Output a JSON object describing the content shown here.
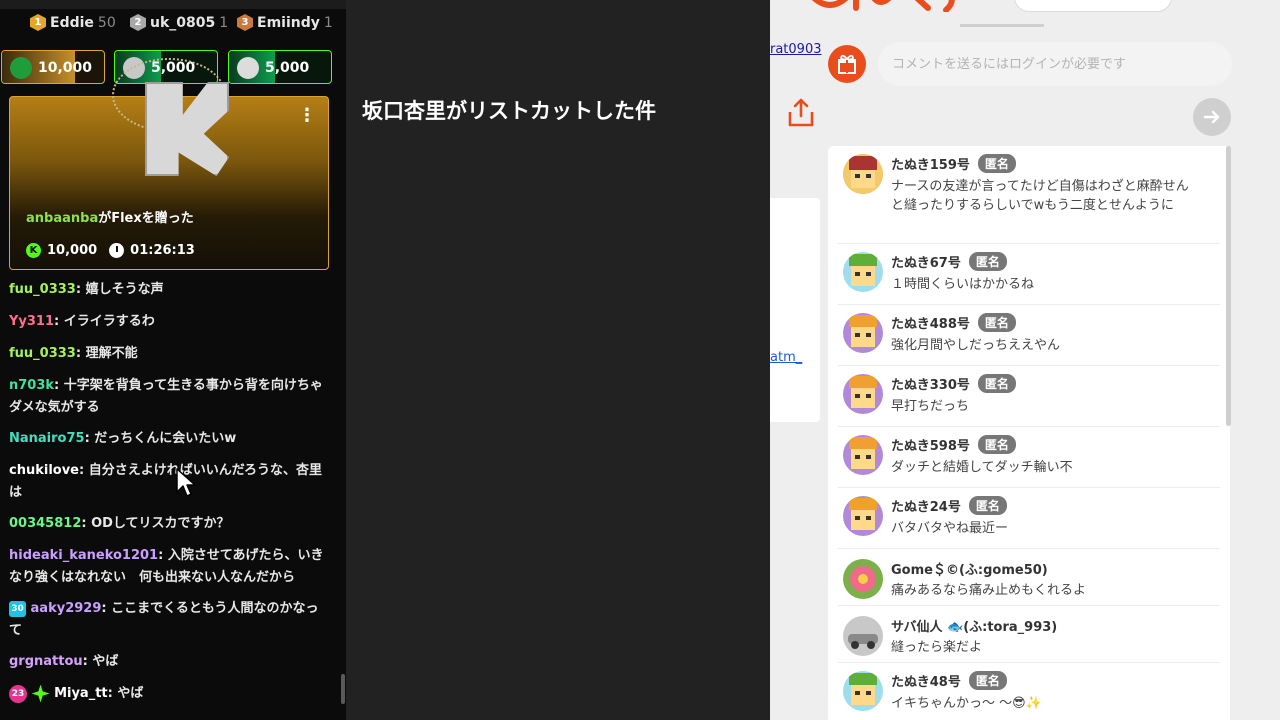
{
  "leaderboard": [
    {
      "rank": "1",
      "name": "Eddie",
      "score": "50",
      "color": "#e3a82b"
    },
    {
      "rank": "2",
      "name": "uk_0805",
      "score": "1",
      "color": "#a8a8a8"
    },
    {
      "rank": "3",
      "name": "Emiindy",
      "score": "1",
      "color": "#c97a3e"
    }
  ],
  "gift_pills": [
    {
      "amount": "10,000",
      "border": "#e0a52e",
      "fill": "#c7902a",
      "fill_fraction": 0.72
    },
    {
      "amount": "5,000",
      "border": "#53fc18",
      "fill": "#0d9d4f",
      "fill_fraction": 0.45
    },
    {
      "amount": "5,000",
      "border": "#53fc18",
      "fill": "#0d9d4f",
      "fill_fraction": 0.45
    }
  ],
  "gift_card": {
    "username": "anbaanba",
    "text": "がFlexを贈った",
    "coins": "10,000",
    "time": "01:26:13"
  },
  "chat": [
    {
      "user": "fuu_0333",
      "color": "#a6f05a",
      "text": ": 嬉しそうな声"
    },
    {
      "user": "Yy311",
      "color": "#ff6e8e",
      "text": ": イライラするわ"
    },
    {
      "user": "fuu_0333",
      "color": "#a6f05a",
      "text": ": 理解不能"
    },
    {
      "user": "n703k",
      "color": "#3fe0a0",
      "text": ": 十字架を背負って生きる事から背を向けちゃダメな気がする"
    },
    {
      "user": "Nanairo75",
      "color": "#3fe0c0",
      "text": ": だっちくんに会いたいw"
    },
    {
      "user": "chukilove",
      "color": "#ffffff",
      "text": ": 自分さえよければいいんだろうな、杏里は"
    },
    {
      "user": "00345812",
      "color": "#6cf58a",
      "text": ": ODしてリスカですか？"
    },
    {
      "user": "hideaki_kaneko1201",
      "color": "#c9a0ff",
      "text": ": 入院させてあげたら、いきなり強くはなれない　何も出来ない人なんだから"
    },
    {
      "user": "aaky2929",
      "color": "#c9a0ff",
      "text": ": ここまでくるともう人間なのかなって",
      "badge": "30"
    },
    {
      "user": "grgnattou",
      "color": "#d6a0ff",
      "text": ": やば"
    },
    {
      "user": "Miya_tt",
      "color": "#ffffff",
      "text": ": やば",
      "badge": "23"
    }
  ],
  "video_title": "坂口杏里がリストカットした件",
  "site": {
    "rat_link": "rat0903",
    "comment_placeholder": "コメントを送るにはログインが必要です",
    "atm_link": "atm_",
    "anon_label": "匿名",
    "brand_color": "#ea4d1c"
  },
  "comments": [
    {
      "name": "たぬき159号",
      "anon": true,
      "avatar": "tanuki-red",
      "text": "ナースの友達が言ってたけど自傷はわざと麻酔せんと縫ったりするらしいでwもう二度とせんように"
    },
    {
      "name": "たぬき67号",
      "anon": true,
      "avatar": "tanuki-green",
      "text": "１時間くらいはかかるね"
    },
    {
      "name": "たぬき488号",
      "anon": true,
      "avatar": "tanuki-purple",
      "text": "強化月間やしだっちええやん"
    },
    {
      "name": "たぬき330号",
      "anon": true,
      "avatar": "tanuki-purple",
      "text": "早打ちだっち"
    },
    {
      "name": "たぬき598号",
      "anon": true,
      "avatar": "tanuki-purple",
      "text": "ダッチと結婚してダッチ輪い不"
    },
    {
      "name": "たぬき24号",
      "anon": true,
      "avatar": "tanuki-purple",
      "text": "バタバタやね最近ー"
    },
    {
      "name": "Gome＄©(ふ:gome50)",
      "anon": false,
      "avatar": "flower",
      "text": "痛みあるなら痛み止めもくれるよ"
    },
    {
      "name": "サバ仙人 🐟(ふ:tora_993)",
      "anon": false,
      "avatar": "car",
      "text": "縫ったら楽だよ"
    },
    {
      "name": "たぬき48号",
      "anon": true,
      "avatar": "tanuki-green",
      "text": "イキちゃんかっ〜 〜😎✨"
    }
  ]
}
